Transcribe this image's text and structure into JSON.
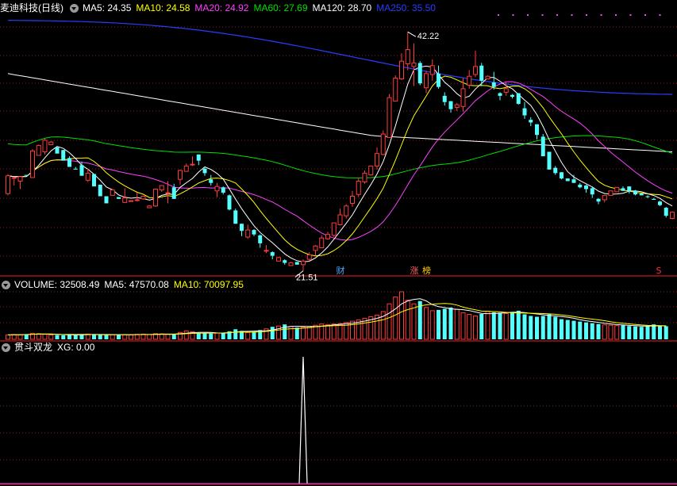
{
  "colors": {
    "up": "#ff3c3c",
    "down": "#53ffff",
    "grid": "#8a1f1f",
    "border": "#a01818",
    "ma5": "#ffffff",
    "ma10": "#ffff00",
    "ma20": "#ff40ff",
    "ma60": "#00e000",
    "ma120": "#ffffff",
    "ma250": "#2a3cff"
  },
  "main": {
    "title": "麦迪科技(日线)",
    "ma": [
      {
        "label": "MA5: 24.35",
        "color": "#ffffff"
      },
      {
        "label": "MA10: 24.58",
        "color": "#ffff00"
      },
      {
        "label": "MA20: 24.92",
        "color": "#ff40ff"
      },
      {
        "label": "MA60: 27.69",
        "color": "#00e000"
      },
      {
        "label": "MA120: 28.70",
        "color": "#ffffff"
      },
      {
        "label": "MA250: 35.50",
        "color": "#2a3cff"
      }
    ],
    "high_label": "42.22",
    "low_label": "21.51",
    "markers": [
      {
        "text": "财",
        "color": "#4aa8ff"
      },
      {
        "text": "涨",
        "color": "#ff6060"
      },
      {
        "text": "榜",
        "color": "#ffd000"
      },
      {
        "text": "S",
        "color": "#ff3030"
      }
    ]
  },
  "volume": {
    "title": "VOLUME: 32508.49",
    "ma5": "MA5: 47570.08",
    "ma10": "MA10: 70097.95"
  },
  "indicator": {
    "title": "贯斗双龙",
    "xg": "XG: 0.00"
  },
  "chart_data": {
    "type": "candlestick",
    "candles": [
      [
        24.0,
        26.0,
        23.8,
        26.2
      ],
      [
        25.8,
        25.8,
        24.9,
        25.9
      ],
      [
        25.4,
        25.9,
        24.5,
        25.9
      ],
      [
        26.1,
        26.0,
        26.1,
        26.1
      ],
      [
        25.8,
        28.8,
        25.8,
        29.0
      ],
      [
        28.3,
        29.4,
        28.3,
        29.5
      ],
      [
        28.7,
        30.0,
        28.4,
        30.2
      ],
      [
        29.5,
        29.8,
        29.6,
        29.9
      ],
      [
        29.2,
        28.5,
        29.2,
        29.3
      ],
      [
        28.9,
        27.7,
        28.6,
        28.9
      ],
      [
        28.0,
        27.0,
        27.0,
        28.2
      ],
      [
        26.8,
        26.7,
        26.8,
        27.0
      ],
      [
        27.2,
        26.0,
        26.8,
        27.6
      ],
      [
        25.5,
        26.3,
        25.3,
        26.8
      ],
      [
        26.2,
        24.8,
        25.5,
        26.2
      ],
      [
        25.0,
        23.7,
        23.7,
        25.0
      ],
      [
        23.7,
        22.9,
        23.6,
        23.7
      ],
      [
        23.8,
        24.4,
        23.8,
        24.5
      ],
      [
        23.6,
        23.4,
        23.5,
        23.6
      ],
      [
        23.0,
        23.5,
        23.0,
        24.6
      ],
      [
        23.2,
        23.2,
        23.2,
        23.2
      ],
      [
        23.3,
        23.3,
        23.1,
        24.1
      ],
      [
        23.4,
        23.7,
        23.3,
        23.7
      ],
      [
        22.4,
        22.6,
        22.6,
        22.7
      ],
      [
        22.6,
        24.5,
        22.5,
        24.5
      ],
      [
        24.4,
        24.9,
        24.2,
        24.9
      ],
      [
        24.1,
        24.1,
        22.9,
        25.4
      ],
      [
        24.7,
        23.4,
        23.4,
        25.1
      ],
      [
        25.6,
        26.6,
        25.0,
        26.7
      ],
      [
        26.5,
        27.1,
        26.5,
        27.4
      ],
      [
        27.3,
        27.3,
        27.1,
        28.2
      ],
      [
        28.4,
        27.7,
        27.2,
        28.4
      ],
      [
        26.8,
        26.3,
        26.0,
        26.9
      ],
      [
        25.6,
        25.2,
        24.9,
        26.1
      ],
      [
        24.3,
        24.8,
        23.6,
        25.2
      ],
      [
        24.7,
        24.1,
        23.9,
        24.8
      ],
      [
        23.8,
        22.2,
        22.1,
        23.9
      ],
      [
        22.1,
        20.6,
        20.6,
        22.3
      ],
      [
        20.6,
        19.8,
        19.2,
        20.6
      ],
      [
        19.1,
        19.9,
        18.9,
        20.5
      ],
      [
        19.9,
        19.4,
        19.2,
        20.0
      ],
      [
        19.3,
        18.4,
        17.9,
        19.4
      ],
      [
        17.6,
        17.6,
        17.3,
        18.2
      ],
      [
        17.4,
        17.0,
        16.6,
        17.5
      ],
      [
        16.4,
        16.8,
        16.4,
        16.9
      ],
      [
        16.5,
        16.2,
        16.0,
        16.6
      ],
      [
        15.9,
        16.2,
        15.9,
        16.3
      ],
      [
        16.3,
        16.0,
        16.0,
        16.3
      ],
      [
        16.0,
        16.4,
        15.3,
        16.6
      ],
      [
        16.6,
        17.1,
        16.4,
        17.4
      ],
      [
        17.6,
        18.1,
        17.0,
        18.2
      ],
      [
        17.9,
        19.0,
        17.9,
        19.3
      ],
      [
        18.9,
        19.4,
        18.8,
        19.7
      ],
      [
        19.3,
        20.7,
        19.1,
        20.7
      ],
      [
        20.5,
        21.6,
        20.4,
        22.3
      ],
      [
        21.5,
        22.6,
        21.2,
        22.8
      ],
      [
        22.9,
        23.7,
        22.5,
        24.3
      ],
      [
        23.9,
        25.4,
        23.6,
        25.8
      ],
      [
        25.3,
        26.3,
        25.1,
        26.6
      ],
      [
        26.1,
        27.1,
        26.0,
        27.1
      ],
      [
        27.1,
        28.5,
        26.7,
        29.2
      ],
      [
        28.4,
        30.7,
        28.3,
        31.1
      ],
      [
        30.3,
        34.8,
        30.3,
        35.2
      ],
      [
        34.4,
        37.0,
        34.4,
        37.3
      ],
      [
        36.9,
        38.9,
        36.8,
        39.8
      ],
      [
        38.6,
        40.2,
        37.9,
        42.2
      ],
      [
        38.3,
        38.7,
        36.1,
        40.9
      ],
      [
        38.7,
        36.4,
        36.2,
        38.9
      ],
      [
        35.9,
        37.5,
        35.3,
        37.8
      ],
      [
        37.4,
        38.4,
        36.7,
        39.1
      ],
      [
        37.5,
        36.0,
        35.8,
        38.4
      ],
      [
        35.0,
        34.3,
        33.9,
        35.4
      ],
      [
        34.4,
        33.5,
        33.1,
        34.4
      ],
      [
        33.7,
        34.0,
        33.3,
        34.2
      ],
      [
        33.8,
        35.8,
        33.2,
        37.0
      ],
      [
        36.2,
        37.2,
        35.8,
        37.9
      ],
      [
        37.4,
        38.3,
        37.1,
        40.1
      ],
      [
        38.4,
        36.7,
        36.1,
        38.7
      ],
      [
        36.9,
        37.2,
        36.9,
        37.3
      ],
      [
        36.5,
        36.0,
        35.7,
        37.7
      ],
      [
        35.3,
        35.0,
        34.5,
        35.4
      ],
      [
        35.4,
        35.8,
        35.0,
        36.6
      ],
      [
        35.1,
        34.9,
        34.7,
        35.2
      ],
      [
        35.3,
        34.1,
        34.0,
        35.3
      ],
      [
        33.6,
        32.8,
        32.4,
        34.3
      ],
      [
        32.3,
        32.0,
        31.6,
        32.6
      ],
      [
        31.8,
        30.6,
        30.1,
        31.8
      ],
      [
        30.4,
        28.2,
        28.2,
        30.7
      ],
      [
        28.7,
        26.7,
        26.7,
        28.7
      ],
      [
        26.9,
        26.3,
        26.1,
        27.1
      ],
      [
        26.4,
        25.7,
        25.6,
        26.4
      ],
      [
        25.7,
        25.4,
        25.4,
        25.7
      ],
      [
        25.6,
        25.2,
        25.2,
        26.1
      ],
      [
        25.0,
        24.7,
        24.6,
        25.2
      ],
      [
        24.9,
        24.5,
        24.1,
        25.0
      ],
      [
        24.6,
        23.9,
        23.5,
        24.8
      ],
      [
        23.4,
        23.1,
        22.8,
        23.5
      ],
      [
        23.3,
        23.8,
        23.0,
        23.8
      ],
      [
        23.8,
        24.3,
        23.8,
        24.3
      ],
      [
        24.2,
        24.7,
        24.2,
        24.7
      ],
      [
        24.6,
        24.3,
        24.3,
        24.8
      ],
      [
        24.8,
        24.3,
        24.0,
        24.8
      ],
      [
        24.3,
        23.9,
        23.8,
        24.4
      ],
      [
        24.0,
        23.8,
        23.8,
        24.0
      ],
      [
        23.7,
        23.6,
        23.5,
        23.8
      ],
      [
        23.4,
        23.3,
        23.3,
        23.5
      ],
      [
        23.1,
        22.7,
        22.6,
        23.2
      ],
      [
        22.4,
        21.5,
        21.3,
        22.5
      ],
      [
        21.2,
        21.9,
        21.1,
        22.0
      ]
    ],
    "candle_fields": [
      "open",
      "close",
      "low",
      "high"
    ],
    "volume": [
      11000,
      12000,
      11500,
      13000,
      15000,
      14000,
      12500,
      11000,
      10500,
      10000,
      12000,
      11000,
      12500,
      13000,
      12000,
      11500,
      11000,
      11500,
      12000,
      11500,
      11000,
      12500,
      13000,
      12000,
      14000,
      13500,
      12500,
      13000,
      17000,
      21000,
      19000,
      16000,
      15000,
      14500,
      15500,
      16000,
      20000,
      25000,
      21000,
      17000,
      19000,
      23000,
      26000,
      31000,
      33000,
      37000,
      32000,
      29000,
      30000,
      32000,
      35000,
      38000,
      36000,
      38000,
      39000,
      42000,
      45000,
      48000,
      52000,
      56000,
      60000,
      69000,
      88000,
      105000,
      118000,
      97000,
      88000,
      95000,
      79000,
      71000,
      73000,
      76000,
      79000,
      74000,
      66000,
      62000,
      58000,
      63000,
      70000,
      67000,
      66000,
      64000,
      68000,
      71000,
      62000,
      58000,
      56000,
      58000,
      62000,
      56000,
      50000,
      48000,
      46000,
      44000,
      42000,
      40000,
      38000,
      36000,
      35000,
      34000,
      35000,
      33000,
      32000,
      31000,
      33000,
      37000,
      34000,
      32508
    ],
    "xg": 0.0,
    "price_range": [
      15.0,
      44.0
    ]
  }
}
